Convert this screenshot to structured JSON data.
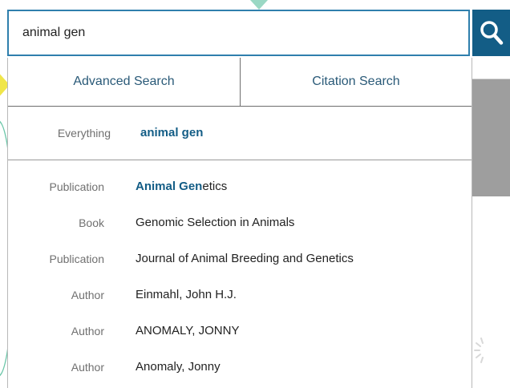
{
  "search": {
    "query": "animal gen",
    "button_icon": "search-icon"
  },
  "tabs": [
    {
      "label": "Advanced Search"
    },
    {
      "label": "Citation Search"
    }
  ],
  "everything": {
    "category": "Everything",
    "value": "animal gen"
  },
  "suggestions": [
    {
      "category": "Publication",
      "highlight": "Animal Gen",
      "rest": "etics"
    },
    {
      "category": "Book",
      "highlight": "",
      "rest": "Genomic Selection in Animals"
    },
    {
      "category": "Publication",
      "highlight": "",
      "rest": "Journal of Animal Breeding and Genetics"
    },
    {
      "category": "Author",
      "highlight": "",
      "rest": "Einmahl, John H.J."
    },
    {
      "category": "Author",
      "highlight": "",
      "rest": "ANOMALY, JONNY"
    },
    {
      "category": "Author",
      "highlight": "",
      "rest": "Anomaly, Jonny"
    }
  ],
  "colors": {
    "accent": "#135d86",
    "border_focus": "#2f7fad",
    "category_text": "#707070"
  }
}
